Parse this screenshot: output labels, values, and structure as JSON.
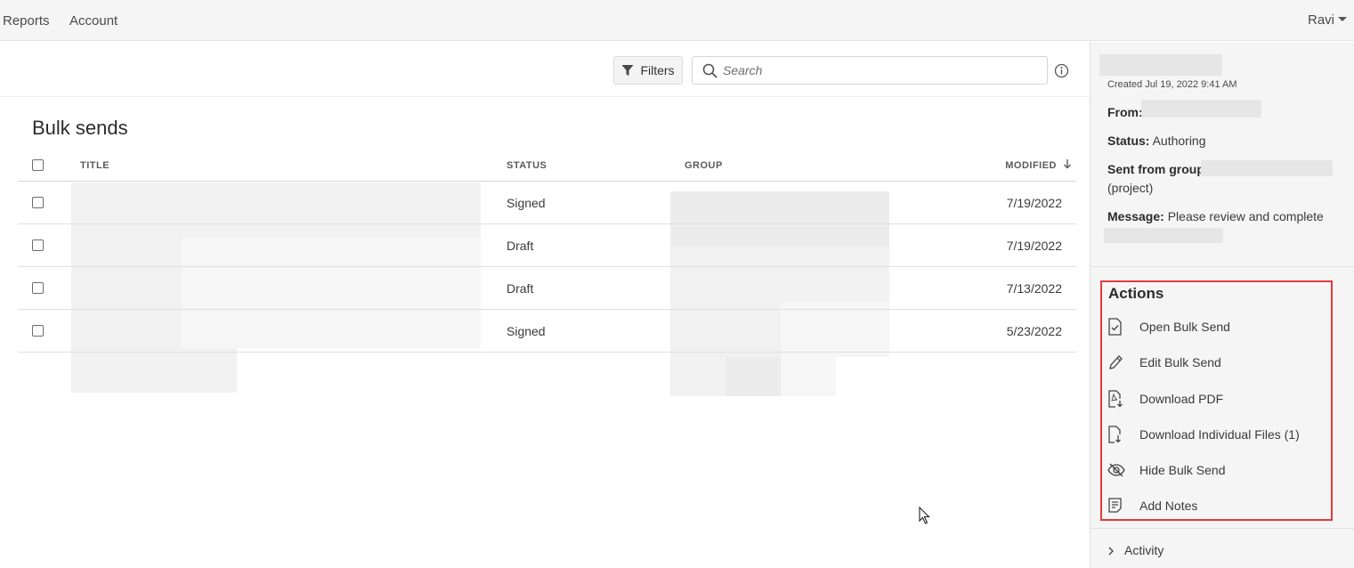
{
  "topnav": {
    "reports": "Reports",
    "account": "Account",
    "user": "Ravi"
  },
  "toolbar": {
    "filters_label": "Filters",
    "search_placeholder": "Search"
  },
  "page_title": "Bulk sends",
  "table": {
    "headers": {
      "title": "TITLE",
      "status": "STATUS",
      "group": "GROUP",
      "modified": "MODIFIED"
    },
    "rows": [
      {
        "status": "Signed",
        "modified": "7/19/2022"
      },
      {
        "status": "Draft",
        "modified": "7/19/2022"
      },
      {
        "status": "Draft",
        "modified": "7/13/2022"
      },
      {
        "status": "Signed",
        "modified": "5/23/2022"
      }
    ]
  },
  "details": {
    "created": "Created Jul 19, 2022 9:41 AM",
    "from_label": "From:",
    "status_label": "Status:",
    "status_value": "Authoring",
    "group_label": "Sent from group:",
    "group_suffix": "(project)",
    "message_label": "Message:",
    "message_value": "Please review and complete"
  },
  "actions": {
    "title": "Actions",
    "items": [
      {
        "label": "Open Bulk Send",
        "icon": "document-check-icon"
      },
      {
        "label": "Edit Bulk Send",
        "icon": "pencil-icon"
      },
      {
        "label": "Download PDF",
        "icon": "pdf-download-icon"
      },
      {
        "label": "Download Individual Files (1)",
        "icon": "file-download-icon"
      },
      {
        "label": "Hide Bulk Send",
        "icon": "eye-off-icon"
      },
      {
        "label": "Add Notes",
        "icon": "notes-icon"
      }
    ]
  },
  "activity_label": "Activity",
  "colors": {
    "highlight": "#e23a3a",
    "sidebar_bg": "#f5f5f5"
  }
}
